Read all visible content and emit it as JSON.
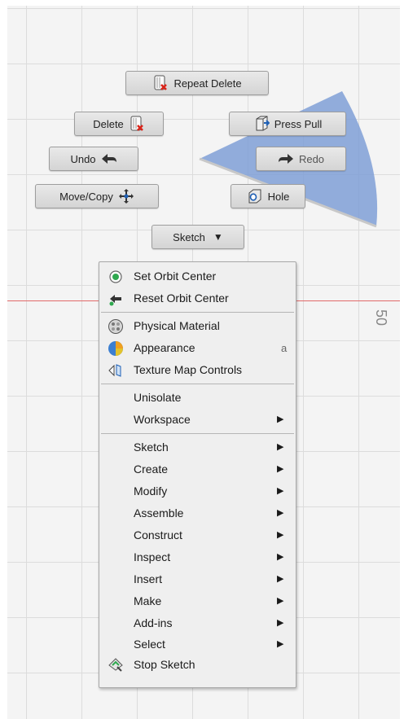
{
  "canvas": {
    "axis_label": "50",
    "axis_color": "#e26a6a",
    "wedge_color": "#7f9fd6"
  },
  "marking_menu": {
    "repeat_delete": "Repeat Delete",
    "delete": "Delete",
    "press_pull": "Press Pull",
    "undo": "Undo",
    "redo": "Redo",
    "move_copy": "Move/Copy",
    "hole": "Hole",
    "sketch": "Sketch"
  },
  "context_menu": {
    "group1": [
      {
        "label": "Set Orbit Center",
        "icon": "orbit-center-icon"
      },
      {
        "label": "Reset Orbit Center",
        "icon": "reset-orbit-icon"
      }
    ],
    "group2": [
      {
        "label": "Physical Material",
        "icon": "physical-material-icon"
      },
      {
        "label": "Appearance",
        "icon": "appearance-icon",
        "shortcut": "a"
      },
      {
        "label": "Texture Map Controls",
        "icon": "texture-map-icon"
      }
    ],
    "group3": [
      {
        "label": "Unisolate"
      },
      {
        "label": "Workspace",
        "submenu": true
      }
    ],
    "group4": [
      {
        "label": "Sketch",
        "submenu": true
      },
      {
        "label": "Create",
        "submenu": true
      },
      {
        "label": "Modify",
        "submenu": true
      },
      {
        "label": "Assemble",
        "submenu": true
      },
      {
        "label": "Construct",
        "submenu": true
      },
      {
        "label": "Inspect",
        "submenu": true
      },
      {
        "label": "Insert",
        "submenu": true
      },
      {
        "label": "Make",
        "submenu": true
      },
      {
        "label": "Add-ins",
        "submenu": true
      },
      {
        "label": "Select",
        "submenu": true
      },
      {
        "label": "Stop Sketch",
        "icon": "stop-sketch-icon"
      }
    ]
  }
}
